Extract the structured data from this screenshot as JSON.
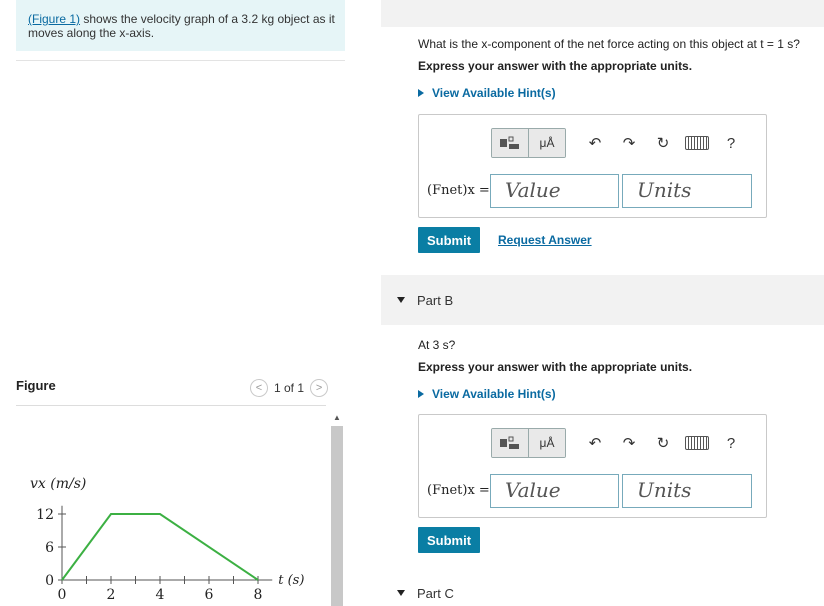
{
  "intro": {
    "link": "(Figure 1)",
    "text": " shows the velocity graph of a 3.2 kg object as it moves along the x-axis."
  },
  "figure": {
    "label": "Figure",
    "pager": "1 of 1",
    "prev_glyph": "<",
    "next_glyph": ">"
  },
  "chart_data": {
    "type": "line",
    "x": [
      0,
      2,
      4,
      8
    ],
    "y": [
      0,
      12,
      12,
      0
    ],
    "xlabel": "t (s)",
    "ylabel": "vx (m/s)",
    "xticks": [
      "0",
      "2",
      "4",
      "6",
      "8"
    ],
    "yticks": [
      "0",
      "6",
      "12"
    ],
    "xlim": [
      0,
      8.5
    ],
    "ylim": [
      0,
      15
    ],
    "grid": false,
    "line_color": "#3cb043"
  },
  "partA": {
    "question": "What is the x-component of the net force acting on this object at t = 1 s?",
    "instruction": "Express your answer with the appropriate units.",
    "hint": "View Available Hint(s)",
    "eq_label": "(Fnet)x =",
    "value_placeholder": "Value",
    "units_placeholder": "Units",
    "submit": "Submit",
    "request": "Request Answer"
  },
  "partB": {
    "title": "Part B",
    "question": "At 3 s?",
    "instruction": "Express your answer with the appropriate units.",
    "hint": "View Available Hint(s)",
    "eq_label": "(Fnet)x =",
    "value_placeholder": "Value",
    "units_placeholder": "Units",
    "submit": "Submit"
  },
  "partC": {
    "title": "Part C"
  },
  "toolbar": {
    "mu_label": "μÅ",
    "undo": "↶",
    "redo": "↷",
    "reset": "↻",
    "help": "?"
  },
  "colors": {
    "accent": "#0a7ea4",
    "link": "#0a6aa1",
    "intro_bg": "#e6f5f7"
  }
}
